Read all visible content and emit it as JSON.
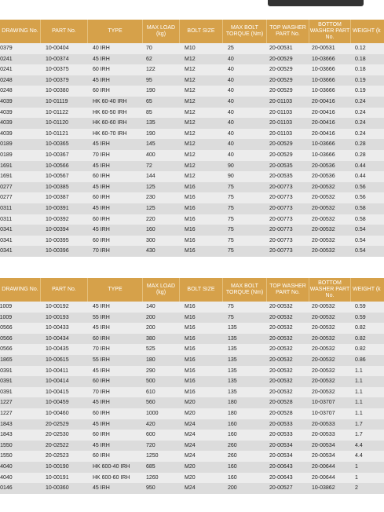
{
  "headers": [
    "DRAWING No.",
    "PART No.",
    "TYPE",
    "MAX LOAD (kg)",
    "BOLT SIZE",
    "MAX BOLT TORQUE (Nm)",
    "TOP WASHER PART No.",
    "BOTTOM WASHER PART No.",
    "WEIGHT (k"
  ],
  "table1": [
    [
      "17-0379",
      "10-00404",
      "40 IRH",
      "70",
      "M10",
      "25",
      "20-00531",
      "20-00531",
      "0.12"
    ],
    [
      "17-0241",
      "10-00374",
      "45 IRH",
      "62",
      "M12",
      "40",
      "20-00529",
      "10-03666",
      "0.18"
    ],
    [
      "17-0241",
      "10-00375",
      "60 IRH",
      "122",
      "M12",
      "40",
      "20-00529",
      "10-03666",
      "0.18"
    ],
    [
      "17-0248",
      "10-00379",
      "45 IRH",
      "95",
      "M12",
      "40",
      "20-00529",
      "10-03666",
      "0.19"
    ],
    [
      "17-0248",
      "10-00380",
      "60 IRH",
      "190",
      "M12",
      "40",
      "20-00529",
      "10-03666",
      "0.19"
    ],
    [
      "17-4039",
      "10-01119",
      "HK 60-40 IRH",
      "65",
      "M12",
      "40",
      "20-01103",
      "20-00416",
      "0.24"
    ],
    [
      "17-4039",
      "10-01122",
      "HK 60-50 IRH",
      "85",
      "M12",
      "40",
      "20-01103",
      "20-00416",
      "0.24"
    ],
    [
      "17-4039",
      "10-01120",
      "HK 60-60 IRH",
      "135",
      "M12",
      "40",
      "20-01103",
      "20-00416",
      "0.24"
    ],
    [
      "17-4039",
      "10-01121",
      "HK 60-70 IRH",
      "190",
      "M12",
      "40",
      "20-01103",
      "20-00416",
      "0.24"
    ],
    [
      "17-0189",
      "10-00365",
      "45 IRH",
      "145",
      "M12",
      "40",
      "20-00529",
      "10-03666",
      "0.28"
    ],
    [
      "17-0189",
      "10-00367",
      "70 IRH",
      "400",
      "M12",
      "40",
      "20-00529",
      "10-03666",
      "0.28"
    ],
    [
      "17-1691",
      "10-00566",
      "45 IRH",
      "72",
      "M12",
      "90",
      "20-00535",
      "20-00536",
      "0.44"
    ],
    [
      "17-1691",
      "10-00567",
      "60 IRH",
      "144",
      "M12",
      "90",
      "20-00535",
      "20-00536",
      "0.44"
    ],
    [
      "17-0277",
      "10-00385",
      "45 IRH",
      "125",
      "M16",
      "75",
      "20-00773",
      "20-00532",
      "0.56"
    ],
    [
      "17-0277",
      "10-00387",
      "60 IRH",
      "230",
      "M16",
      "75",
      "20-00773",
      "20-00532",
      "0.56"
    ],
    [
      "17-0311",
      "10-00391",
      "45 IRH",
      "125",
      "M16",
      "75",
      "20-00773",
      "20-00532",
      "0.58"
    ],
    [
      "17-0311",
      "10-00392",
      "60 IRH",
      "220",
      "M16",
      "75",
      "20-00773",
      "20-00532",
      "0.58"
    ],
    [
      "17-0341",
      "10-00394",
      "45 IRH",
      "160",
      "M16",
      "75",
      "20-00773",
      "20-00532",
      "0.54"
    ],
    [
      "17-0341",
      "10-00395",
      "60 IRH",
      "300",
      "M16",
      "75",
      "20-00773",
      "20-00532",
      "0.54"
    ],
    [
      "17-0341",
      "10-00396",
      "70 IRH",
      "430",
      "M16",
      "75",
      "20-00773",
      "20-00532",
      "0.54"
    ]
  ],
  "table2": [
    [
      "11-1009",
      "10-00192",
      "45 IRH",
      "140",
      "M16",
      "75",
      "20-00532",
      "20-00532",
      "0.59"
    ],
    [
      "11-1009",
      "10-00193",
      "55 IRH",
      "200",
      "M16",
      "75",
      "20-00532",
      "20-00532",
      "0.59"
    ],
    [
      "17-0566",
      "10-00433",
      "45 IRH",
      "200",
      "M16",
      "135",
      "20-00532",
      "20-00532",
      "0.82"
    ],
    [
      "17-0566",
      "10-00434",
      "60 IRH",
      "380",
      "M16",
      "135",
      "20-00532",
      "20-00532",
      "0.82"
    ],
    [
      "17-0566",
      "10-00435",
      "70 IRH",
      "525",
      "M16",
      "135",
      "20-00532",
      "20-00532",
      "0.82"
    ],
    [
      "17-1865",
      "10-00615",
      "55 IRH",
      "180",
      "M16",
      "135",
      "20-00532",
      "20-00532",
      "0.86"
    ],
    [
      "17-0391",
      "10-00411",
      "45 IRH",
      "290",
      "M16",
      "135",
      "20-00532",
      "20-00532",
      "1.1"
    ],
    [
      "17-0391",
      "10-00414",
      "60 IRH",
      "500",
      "M16",
      "135",
      "20-00532",
      "20-00532",
      "1.1"
    ],
    [
      "17-0391",
      "10-00415",
      "70 IRH",
      "610",
      "M16",
      "135",
      "20-00532",
      "20-00532",
      "1.1"
    ],
    [
      "17-1227",
      "10-00459",
      "45 IRH",
      "560",
      "M20",
      "180",
      "20-00528",
      "10-03707",
      "1.1"
    ],
    [
      "17-1227",
      "10-00460",
      "60 IRH",
      "1000",
      "M20",
      "180",
      "20-00528",
      "10-03707",
      "1.1"
    ],
    [
      "17-1843",
      "20-02529",
      "45 IRH",
      "420",
      "M24",
      "160",
      "20-00533",
      "20-00533",
      "1.7"
    ],
    [
      "17-1843",
      "20-02530",
      "60 IRH",
      "600",
      "M24",
      "160",
      "20-00533",
      "20-00533",
      "1.7"
    ],
    [
      "17-1550",
      "20-02522",
      "45 IRH",
      "720",
      "M24",
      "260",
      "20-00534",
      "20-00534",
      "4.4"
    ],
    [
      "17-1550",
      "20-02523",
      "60 IRH",
      "1250",
      "M24",
      "260",
      "20-00534",
      "20-00534",
      "4.4"
    ],
    [
      "17-4040",
      "10-00190",
      "HK 600-40 IRH",
      "685",
      "M20",
      "160",
      "20-00643",
      "20-00644",
      "1"
    ],
    [
      "17-4040",
      "10-00191",
      "HK 600-60 IRH",
      "1260",
      "M20",
      "160",
      "20-00643",
      "20-00644",
      "1"
    ],
    [
      "17-0146",
      "10-00360",
      "45 IRH",
      "950",
      "M24",
      "200",
      "20-00527",
      "10-03862",
      "2"
    ]
  ]
}
